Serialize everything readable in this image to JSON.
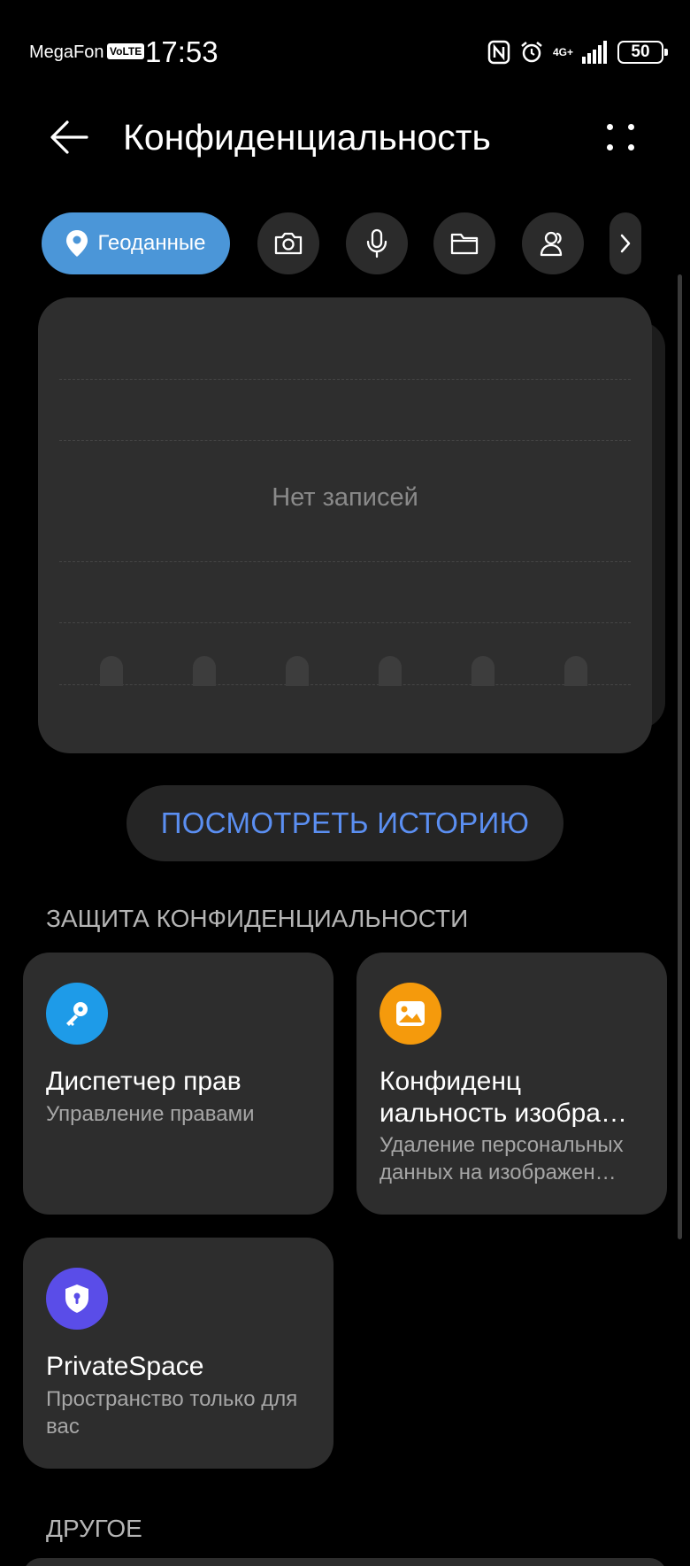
{
  "status_bar": {
    "carrier": "MegaFon",
    "volte": "VoLTE",
    "time": "17:53",
    "network": "4G+",
    "battery": "50"
  },
  "header": {
    "title": "Конфиденциальность"
  },
  "chips": [
    {
      "label": "Геоданные",
      "icon": "location-pin-icon",
      "active": true
    },
    {
      "label": "",
      "icon": "camera-icon",
      "active": false
    },
    {
      "label": "",
      "icon": "microphone-icon",
      "active": false
    },
    {
      "label": "",
      "icon": "folder-icon",
      "active": false
    },
    {
      "label": "",
      "icon": "contacts-icon",
      "active": false
    },
    {
      "label": "",
      "icon": "chevron-right-icon",
      "active": false
    }
  ],
  "usage_panel": {
    "empty_text": "Нет записей"
  },
  "history_button": "ПОСМОТРЕТЬ ИСТОРИЮ",
  "protection_section": {
    "title": "ЗАЩИТА КОНФИДЕНЦИАЛЬНОСТИ",
    "cards": [
      {
        "title": "Диспетчер прав",
        "subtitle": "Управление правами",
        "icon": "key-icon",
        "icon_color": "#1e9be8"
      },
      {
        "title": "Конфиденц иальность изобра…",
        "subtitle": "Удаление персональных данных на изображен…",
        "icon": "image-icon",
        "icon_color": "#f59a0c"
      },
      {
        "title": "PrivateSpace",
        "subtitle": "Пространство только для вас",
        "icon": "shield-icon",
        "icon_color": "#5a4de8"
      }
    ]
  },
  "other_section": {
    "title": "ДРУГОЕ"
  },
  "colors": {
    "accent": "#5b8ff2",
    "chip_active": "#4b96d8",
    "card_bg": "#2d2d2d"
  }
}
